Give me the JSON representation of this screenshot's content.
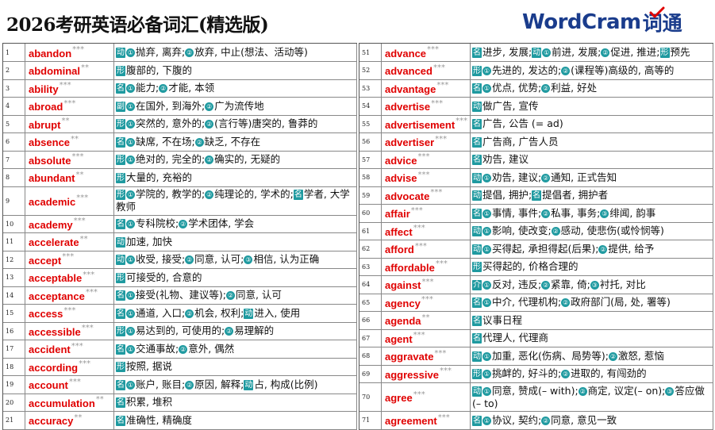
{
  "title": "2026考研英语必备词汇(精选版)",
  "logo": {
    "text_en": "WordCram",
    "text_cn": "词通"
  },
  "colors": {
    "headword": "#e00000",
    "pos_badge": "#1f9aa0",
    "logo": "#1a3c8c",
    "check": "#e00000"
  },
  "left_column": [
    {
      "n": "1",
      "word": "abandon",
      "star": "***",
      "defs": [
        {
          "pos": "动",
          "segs": [
            "①抛弃, 离弃;",
            "②放弃, 中止(想法、活动等)"
          ]
        }
      ]
    },
    {
      "n": "2",
      "word": "abdominal",
      "star": "**",
      "defs": [
        {
          "pos": "形",
          "segs": [
            "腹部的, 下腹的"
          ]
        }
      ]
    },
    {
      "n": "3",
      "word": "ability",
      "star": "***",
      "defs": [
        {
          "pos": "名",
          "segs": [
            "①能力;",
            "②才能, 本领"
          ]
        }
      ]
    },
    {
      "n": "4",
      "word": "abroad",
      "star": "***",
      "defs": [
        {
          "pos": "副",
          "segs": [
            "①在国外, 到海外;",
            "②广为流传地"
          ]
        }
      ]
    },
    {
      "n": "5",
      "word": "abrupt",
      "star": "**",
      "defs": [
        {
          "pos": "形",
          "segs": [
            "①突然的, 意外的;",
            "②(言行等)唐突的, 鲁莽的"
          ]
        }
      ]
    },
    {
      "n": "6",
      "word": "absence",
      "star": "**",
      "defs": [
        {
          "pos": "名",
          "segs": [
            "①缺席, 不在场;",
            "②缺乏, 不存在"
          ]
        }
      ]
    },
    {
      "n": "7",
      "word": "absolute",
      "star": "***",
      "defs": [
        {
          "pos": "形",
          "segs": [
            "①绝对的, 完全的;",
            "②确实的, 无疑的"
          ]
        }
      ]
    },
    {
      "n": "8",
      "word": "abundant",
      "star": "**",
      "defs": [
        {
          "pos": "形",
          "segs": [
            "大量的, 充裕的"
          ]
        }
      ]
    },
    {
      "n": "9",
      "word": "academic",
      "star": "***",
      "defs": [
        {
          "pos": "形",
          "segs": [
            "①学院的, 教学的;",
            "②纯理论的, 学术的;"
          ]
        },
        {
          "pos": "名",
          "segs": [
            "学者, 大学教师"
          ]
        }
      ]
    },
    {
      "n": "10",
      "word": "academy",
      "star": "***",
      "defs": [
        {
          "pos": "名",
          "segs": [
            "①专科院校;",
            "②学术团体, 学会"
          ]
        }
      ]
    },
    {
      "n": "11",
      "word": "accelerate",
      "star": "**",
      "defs": [
        {
          "pos": "动",
          "segs": [
            "加速, 加快"
          ]
        }
      ]
    },
    {
      "n": "12",
      "word": "accept",
      "star": "***",
      "defs": [
        {
          "pos": "动",
          "segs": [
            "①收受, 接受;",
            "②同意, 认可;",
            "③相信, 认为正确"
          ]
        }
      ]
    },
    {
      "n": "13",
      "word": "acceptable",
      "star": "***",
      "defs": [
        {
          "pos": "形",
          "segs": [
            "可接受的, 合意的"
          ]
        }
      ]
    },
    {
      "n": "14",
      "word": "acceptance",
      "star": "***",
      "defs": [
        {
          "pos": "名",
          "segs": [
            "①接受(礼物、建议等);",
            "②同意, 认可"
          ]
        }
      ]
    },
    {
      "n": "15",
      "word": "access",
      "star": "***",
      "defs": [
        {
          "pos": "名",
          "segs": [
            "①通道, 入口;",
            "②机会, 权利;"
          ]
        },
        {
          "pos": "动",
          "segs": [
            "进入, 使用"
          ]
        }
      ]
    },
    {
      "n": "16",
      "word": "accessible",
      "star": "***",
      "defs": [
        {
          "pos": "形",
          "segs": [
            "①易达到的, 可使用的;",
            "②易理解的"
          ]
        }
      ]
    },
    {
      "n": "17",
      "word": "accident",
      "star": "***",
      "defs": [
        {
          "pos": "名",
          "segs": [
            "①交通事故;",
            "②意外, 偶然"
          ]
        }
      ]
    },
    {
      "n": "18",
      "word": "according",
      "star": "***",
      "defs": [
        {
          "pos": "形",
          "segs": [
            "按照, 据说"
          ]
        }
      ]
    },
    {
      "n": "19",
      "word": "account",
      "star": "***",
      "defs": [
        {
          "pos": "名",
          "segs": [
            "①账户, 账目;",
            "②原因, 解释;"
          ]
        },
        {
          "pos": "动",
          "segs": [
            "占, 构成(比例)"
          ]
        }
      ]
    },
    {
      "n": "20",
      "word": "accumulation",
      "star": "**",
      "defs": [
        {
          "pos": "名",
          "segs": [
            "积累, 堆积"
          ]
        }
      ]
    },
    {
      "n": "21",
      "word": "accuracy",
      "star": "**",
      "defs": [
        {
          "pos": "名",
          "segs": [
            "准确性, 精确度"
          ]
        }
      ]
    }
  ],
  "right_column": [
    {
      "n": "51",
      "word": "advance",
      "star": "***",
      "defs": [
        {
          "pos": "名",
          "segs": [
            "进步, 发展;"
          ]
        },
        {
          "pos": "动",
          "segs": [
            "①前进, 发展;",
            "②促进, 推进;"
          ]
        },
        {
          "pos": "形",
          "segs": [
            "预先"
          ]
        }
      ]
    },
    {
      "n": "52",
      "word": "advanced",
      "star": "***",
      "defs": [
        {
          "pos": "形",
          "segs": [
            "①先进的, 发达的;",
            "②(课程等)高级的, 高等的"
          ]
        }
      ]
    },
    {
      "n": "53",
      "word": "advantage",
      "star": "***",
      "defs": [
        {
          "pos": "名",
          "segs": [
            "①优点, 优势;",
            "②利益, 好处"
          ]
        }
      ]
    },
    {
      "n": "54",
      "word": "advertise",
      "star": "***",
      "defs": [
        {
          "pos": "动",
          "segs": [
            "做广告, 宣传"
          ]
        }
      ]
    },
    {
      "n": "55",
      "word": "advertisement",
      "star": "***",
      "defs": [
        {
          "pos": "名",
          "segs": [
            "广告, 公告 (= ad)"
          ]
        }
      ]
    },
    {
      "n": "56",
      "word": "advertiser",
      "star": "***",
      "defs": [
        {
          "pos": "名",
          "segs": [
            "广告商, 广告人员"
          ]
        }
      ]
    },
    {
      "n": "57",
      "word": "advice",
      "star": "***",
      "defs": [
        {
          "pos": "名",
          "segs": [
            "劝告, 建议"
          ]
        }
      ]
    },
    {
      "n": "58",
      "word": "advise",
      "star": "***",
      "defs": [
        {
          "pos": "动",
          "segs": [
            "①劝告, 建议;",
            "②通知, 正式告知"
          ]
        }
      ]
    },
    {
      "n": "59",
      "word": "advocate",
      "star": "***",
      "defs": [
        {
          "pos": "动",
          "segs": [
            "提倡, 拥护;"
          ]
        },
        {
          "pos": "名",
          "segs": [
            "提倡者, 拥护者"
          ]
        }
      ]
    },
    {
      "n": "60",
      "word": "affair",
      "star": "***",
      "defs": [
        {
          "pos": "名",
          "segs": [
            "①事情, 事件;",
            "②私事, 事务;",
            "③绯闻, 韵事"
          ]
        }
      ]
    },
    {
      "n": "61",
      "word": "affect",
      "star": "***",
      "defs": [
        {
          "pos": "动",
          "segs": [
            "①影响, 使改变;",
            "②感动, 使悲伤(或怜悯等)"
          ]
        }
      ]
    },
    {
      "n": "62",
      "word": "afford",
      "star": "***",
      "defs": [
        {
          "pos": "动",
          "segs": [
            "①买得起, 承担得起(后果);",
            "②提供, 给予"
          ]
        }
      ]
    },
    {
      "n": "63",
      "word": "affordable",
      "star": "***",
      "defs": [
        {
          "pos": "形",
          "segs": [
            "买得起的, 价格合理的"
          ]
        }
      ]
    },
    {
      "n": "64",
      "word": "against",
      "star": "***",
      "defs": [
        {
          "pos": "介",
          "segs": [
            "①反对, 违反;",
            "②紧靠, 倚;",
            "③衬托, 对比"
          ]
        }
      ]
    },
    {
      "n": "65",
      "word": "agency",
      "star": "***",
      "defs": [
        {
          "pos": "名",
          "segs": [
            "①中介, 代理机构;",
            "②政府部门(局, 处, 署等)"
          ]
        }
      ]
    },
    {
      "n": "66",
      "word": "agenda",
      "star": "**",
      "defs": [
        {
          "pos": "名",
          "segs": [
            "议事日程"
          ]
        }
      ]
    },
    {
      "n": "67",
      "word": "agent",
      "star": "***",
      "defs": [
        {
          "pos": "名",
          "segs": [
            "代理人, 代理商"
          ]
        }
      ]
    },
    {
      "n": "68",
      "word": "aggravate",
      "star": "***",
      "defs": [
        {
          "pos": "动",
          "segs": [
            "①加重, 恶化(伤病、局势等);",
            "②激怒, 惹恼"
          ]
        }
      ]
    },
    {
      "n": "69",
      "word": "aggressive",
      "star": "***",
      "defs": [
        {
          "pos": "形",
          "segs": [
            "①挑衅的, 好斗的;",
            "②进取的, 有闯劲的"
          ]
        }
      ]
    },
    {
      "n": "70",
      "word": "agree",
      "star": "***",
      "defs": [
        {
          "pos": "动",
          "segs": [
            "①同意, 赞成(– with);",
            "②商定, 议定(– on);",
            "③答应做(– to)"
          ]
        }
      ]
    },
    {
      "n": "71",
      "word": "agreement",
      "star": "***",
      "defs": [
        {
          "pos": "名",
          "segs": [
            "①协议, 契约;",
            "②同意, 意见一致"
          ]
        }
      ]
    }
  ]
}
